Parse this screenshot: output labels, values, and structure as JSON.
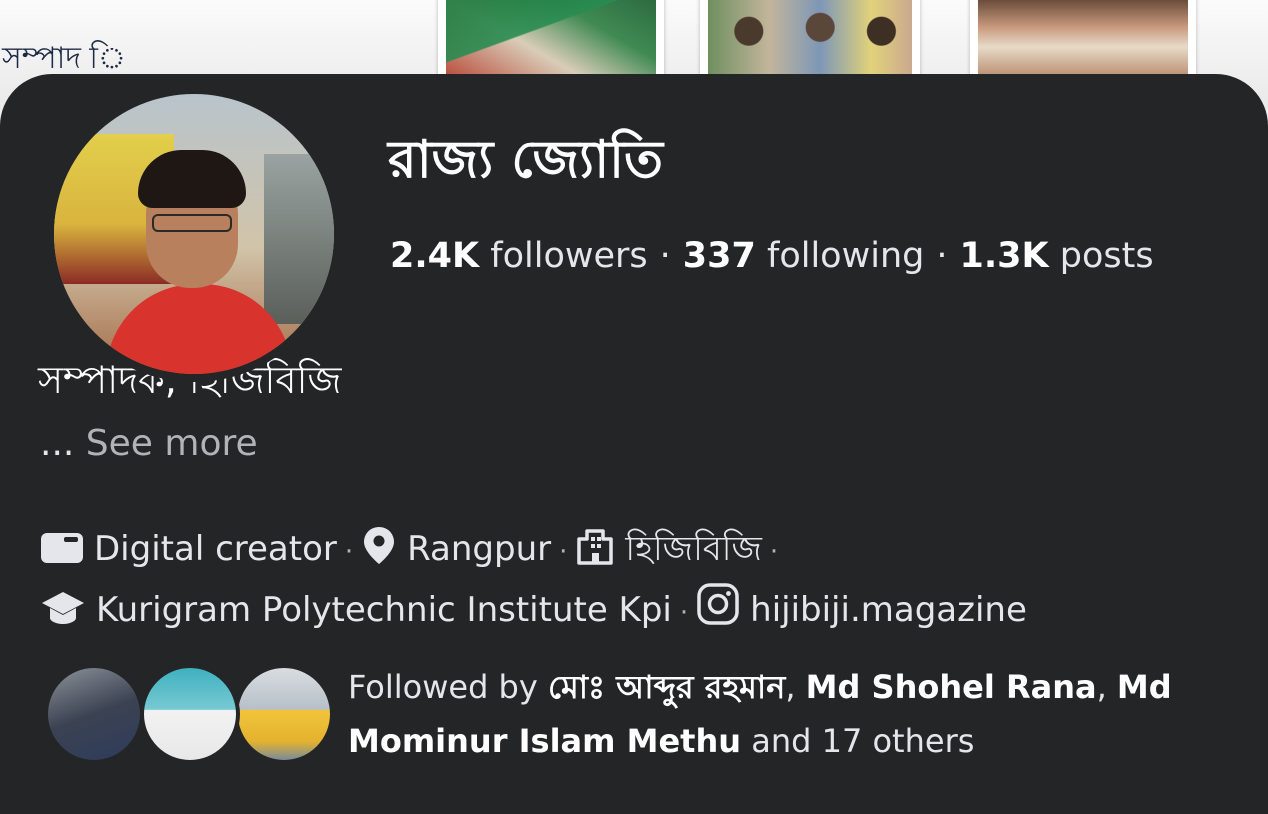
{
  "cover": {
    "title_fragment": "",
    "subtitle_fragment": "সম্পাদ                ি"
  },
  "profile": {
    "name": "রাজ্য জ্যোতি",
    "followers_count": "2.4K",
    "followers_label": "followers",
    "following_count": "337",
    "following_label": "following",
    "posts_count": "1.3K",
    "posts_label": "posts",
    "bio": "সম্পাদক, হিজিবিজি",
    "see_more_prefix": "...",
    "see_more_label": "See more"
  },
  "details": [
    {
      "icon": "briefcase-icon",
      "text": "Digital creator"
    },
    {
      "icon": "location-pin-icon",
      "text": "Rangpur"
    },
    {
      "icon": "building-icon",
      "text": "হিজিবিজি"
    },
    {
      "icon": "graduation-cap-icon",
      "text": "Kurigram Polytechnic Institute Kpi"
    },
    {
      "icon": "instagram-icon",
      "text": "hijibiji.magazine"
    }
  ],
  "followed_by": {
    "prefix": "Followed by",
    "names": [
      "মোঃ আব্দুর রহমান",
      "Md Shohel Rana",
      "Md Mominur Islam Methu"
    ],
    "suffix": "and 17 others"
  },
  "colors": {
    "card_background": "#242526",
    "primary_text": "#e4e6eb",
    "secondary_text": "#b0b3b8"
  }
}
